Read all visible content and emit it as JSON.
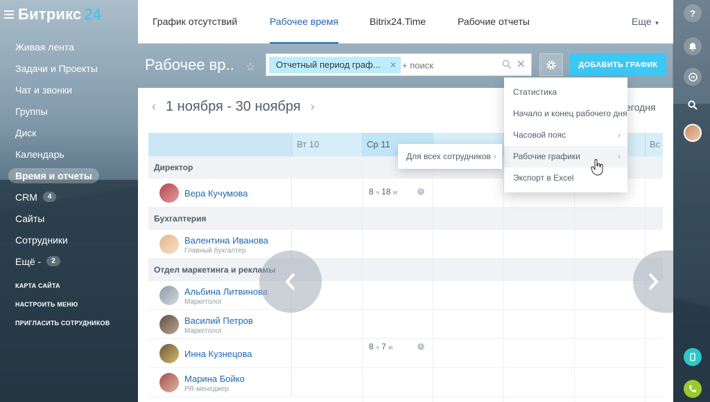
{
  "app": {
    "logo_text": "Битрикс",
    "logo_num": "24"
  },
  "sidebar": {
    "items": [
      {
        "label": "Живая лента"
      },
      {
        "label": "Задачи и Проекты"
      },
      {
        "label": "Чат и звонки"
      },
      {
        "label": "Группы"
      },
      {
        "label": "Диск"
      },
      {
        "label": "Календарь"
      },
      {
        "label": "Время и отчеты",
        "active": true
      },
      {
        "label": "CRM",
        "counter": "4"
      },
      {
        "label": "Сайты"
      },
      {
        "label": "Сотрудники"
      },
      {
        "label": "Ещё -",
        "counter": "2"
      }
    ],
    "links": [
      "КАРТА САЙТА",
      "НАСТРОИТЬ МЕНЮ",
      "ПРИГЛАСИТЬ СОТРУДНИКОВ"
    ]
  },
  "tabs": {
    "t1": "График отсутствий",
    "t2": "Рабочее время",
    "t3": "Bitrix24.Time",
    "t4": "Рабочие отчеты",
    "more": "Еще"
  },
  "page": {
    "title": "Рабочее вр...",
    "filter_chip": "Отчетный период граф...",
    "search_placeholder": "+ поиск",
    "add_button": "ДОБАВИТЬ ГРАФИК",
    "period": "1 ноября - 30 ноября",
    "today": "егодня"
  },
  "grid": {
    "days": [
      "Вт 10",
      "Ср 11",
      "Вс"
    ],
    "depts": [
      "Директор",
      "Бухгалтерия",
      "Отдел маркетинга и рекламы"
    ],
    "employees": [
      {
        "name": "Вера Кучумова",
        "position": ""
      },
      {
        "name": "Валентина Иванова",
        "position": "Главный бухгалтер"
      },
      {
        "name": "Альбина Литвинова",
        "position": "Маркетолог"
      },
      {
        "name": "Василий Петров",
        "position": "Маркетолог"
      },
      {
        "name": "Инна Кузнецова",
        "position": ""
      },
      {
        "name": "Марина Бойко",
        "position": "PR-менеджер"
      }
    ],
    "times": [
      {
        "h": "8",
        "hu": "ч",
        "m": "18",
        "mu": "м"
      },
      {
        "h": "8",
        "hu": "ч",
        "m": "7",
        "mu": "м"
      }
    ]
  },
  "dropdown": {
    "items": [
      "Статистика",
      "Начало и конец рабочего дня",
      "Часовой пояс",
      "Рабочие графики",
      "Экспорт в Excel"
    ],
    "submenu": "Для всех сотрудников"
  }
}
